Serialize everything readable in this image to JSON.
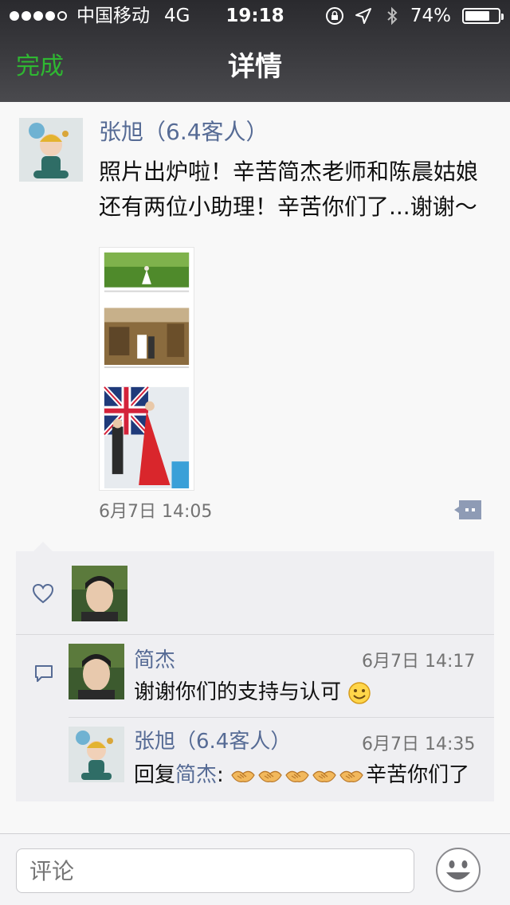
{
  "status_bar": {
    "carrier": "中国移动",
    "network": "4G",
    "time": "19:18",
    "battery": "74%",
    "battery_level": 0.74
  },
  "nav": {
    "done": "完成",
    "title": "详情"
  },
  "post": {
    "author": "张旭（6.4客人）",
    "text": "照片出炉啦！辛苦简杰老师和陈晨姑娘还有两位小助理！辛苦你们了...谢谢～",
    "time": "6月7日 14:05"
  },
  "comments": [
    {
      "author": "简杰",
      "time": "6月7日 14:17",
      "text": "谢谢你们的支持与认可"
    },
    {
      "author": "张旭（6.4客人）",
      "time": "6月7日 14:35",
      "reply_prefix": "回复",
      "reply_to": "简杰",
      "colon": ":",
      "text_suffix": "辛苦你们了"
    }
  ],
  "input": {
    "placeholder": "评论"
  },
  "colors": {
    "accent_green": "#2fb732",
    "name_blue": "#566b95"
  }
}
